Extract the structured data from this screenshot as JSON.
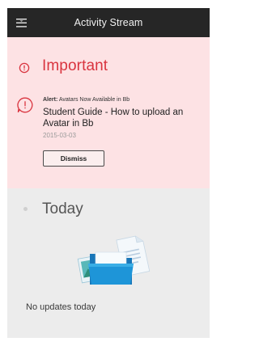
{
  "header": {
    "title": "Activity Stream",
    "menu_icon": "hamburger-menu-icon"
  },
  "important": {
    "title": "Important",
    "header_icon": "exclamation-circle-icon",
    "alert": {
      "icon": "alert-circle-icon",
      "label": "Alert:",
      "subtitle": "Avatars Now Available in Bb",
      "title": "Student Guide - How to upload an Avatar in Bb",
      "date": "2015-03-03",
      "dismiss_label": "Dismiss"
    }
  },
  "today": {
    "title": "Today",
    "empty_illustration": "folder-documents-illustration",
    "empty_text": "No updates today"
  },
  "colors": {
    "topbar": "#262626",
    "important_bg": "#fde2e4",
    "accent_red": "#d9343f",
    "today_bg": "#ececec",
    "folder_blue": "#1e95d8"
  }
}
